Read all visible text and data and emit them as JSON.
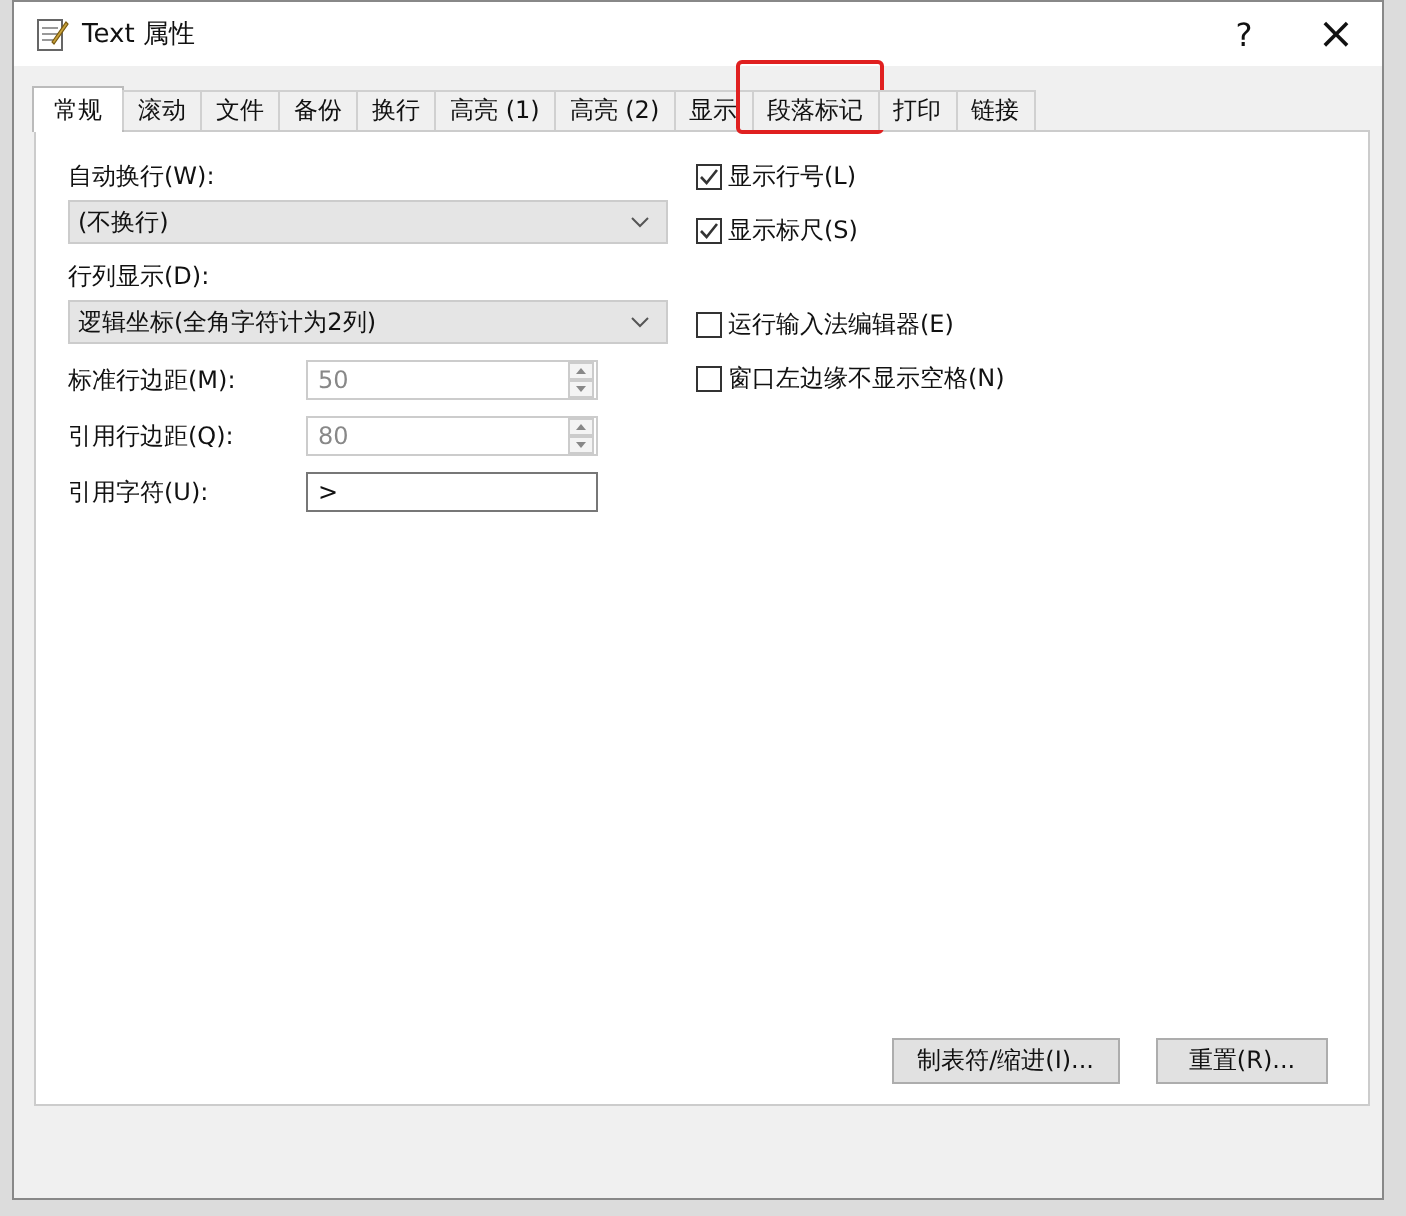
{
  "window": {
    "title": "Text 属性",
    "help": "?",
    "close": "×"
  },
  "tabs": [
    {
      "label": "常规",
      "selected": true,
      "highlighted": false
    },
    {
      "label": "滚动",
      "selected": false,
      "highlighted": false
    },
    {
      "label": "文件",
      "selected": false,
      "highlighted": false
    },
    {
      "label": "备份",
      "selected": false,
      "highlighted": false
    },
    {
      "label": "换行",
      "selected": false,
      "highlighted": false
    },
    {
      "label": "高亮 (1)",
      "selected": false,
      "highlighted": false
    },
    {
      "label": "高亮 (2)",
      "selected": false,
      "highlighted": false
    },
    {
      "label": "显示",
      "selected": false,
      "highlighted": false
    },
    {
      "label": "段落标记",
      "selected": false,
      "highlighted": true
    },
    {
      "label": "打印",
      "selected": false,
      "highlighted": false
    },
    {
      "label": "链接",
      "selected": false,
      "highlighted": false
    }
  ],
  "dropdowns": [
    {
      "label": "自动换行(W):",
      "value": "(不换行)"
    },
    {
      "label": "行列显示(D):",
      "value": "逻辑坐标(全角字符计为2列)"
    }
  ],
  "fields": [
    {
      "kind": "spinner",
      "label": "标准行边距(M):",
      "value": "50",
      "disabled": true
    },
    {
      "kind": "spinner",
      "label": "引用行边距(Q):",
      "value": "80",
      "disabled": true
    },
    {
      "kind": "text",
      "label": "引用字符(U):",
      "value": ">",
      "disabled": false
    }
  ],
  "checkbox_groups": [
    [
      {
        "label": "显示行号(L)",
        "checked": true
      },
      {
        "label": "显示标尺(S)",
        "checked": true
      }
    ],
    [
      {
        "label": "运行输入法编辑器(E)",
        "checked": false
      },
      {
        "label": "窗口左边缘不显示空格(N)",
        "checked": false
      }
    ]
  ],
  "buttons": [
    "制表符/缩进(I)...",
    "重置(R)..."
  ]
}
